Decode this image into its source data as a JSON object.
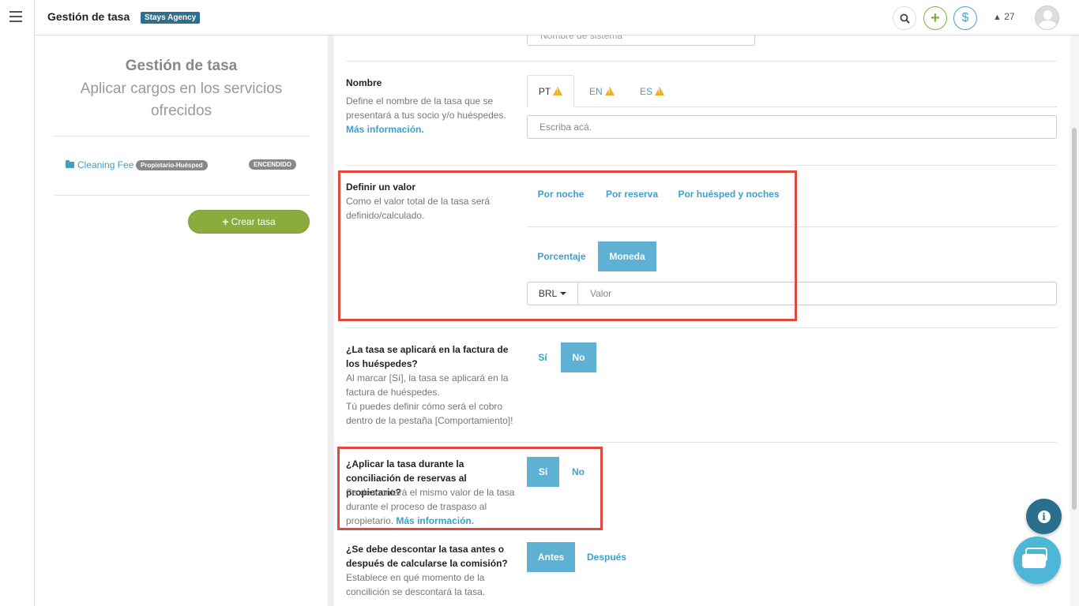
{
  "header": {
    "title": "Gestión de tasa",
    "agency": "Stays Agency",
    "alerts_count": "27"
  },
  "left_panel": {
    "title": "Gestión de tasa",
    "subtitle": "Aplicar cargos en los servicios ofrecidos",
    "fee": {
      "name": "Cleaning Fee",
      "type": "Propietario-Huésped",
      "status": "ENCENDIDO"
    },
    "create_label": "Crear tasa"
  },
  "form": {
    "system_name_placeholder": "Nombre de sistema",
    "name": {
      "title": "Nombre",
      "desc": "Define el nombre de la tasa que se presentará a tus socio y/o huéspedes.",
      "link": "Más información.",
      "tabs": [
        "PT",
        "EN",
        "ES"
      ],
      "placeholder": "Escriba acá."
    },
    "value": {
      "title": "Definir un valor",
      "desc": "Como el valor total de la tasa será definido/calculado.",
      "modes": [
        "Por noche",
        "Por reserva",
        "Por huésped y noches"
      ],
      "types": [
        "Porcentaje",
        "Moneda"
      ],
      "selected_type": "Moneda",
      "currency": "BRL",
      "value_placeholder": "Valor"
    },
    "invoice": {
      "title": "¿La tasa se aplicará en la factura de los huéspedes?",
      "desc1": "Al marcar [Sí], la tasa se aplicará en la factura de huéspedes.",
      "desc2": "Tú puedes definir cómo será el cobro dentro de la pestaña [Comportamiento]!",
      "yes": "Sí",
      "no": "No",
      "selected": "No"
    },
    "reconciliation": {
      "title": "¿Aplicar la tasa durante la conciliación de reservas al propietario?",
      "desc": "Se descontará el mismo valor de la tasa durante el proceso de traspaso al propietario.",
      "link": "Más información.",
      "yes": "Sí",
      "no": "No",
      "selected": "Sí"
    },
    "commission": {
      "title": "¿Se debe descontar la tasa antes o después de calcularse la comisión?",
      "desc": "Establece en qué momento de la concilición se descontará la tasa.",
      "before": "Antes",
      "after": "Después",
      "selected": "Antes"
    }
  },
  "colors": {
    "accent": "#3ea0c8",
    "selected": "#5eb1d3",
    "highlight": "#e04a3c",
    "create": "#8aac3e"
  }
}
